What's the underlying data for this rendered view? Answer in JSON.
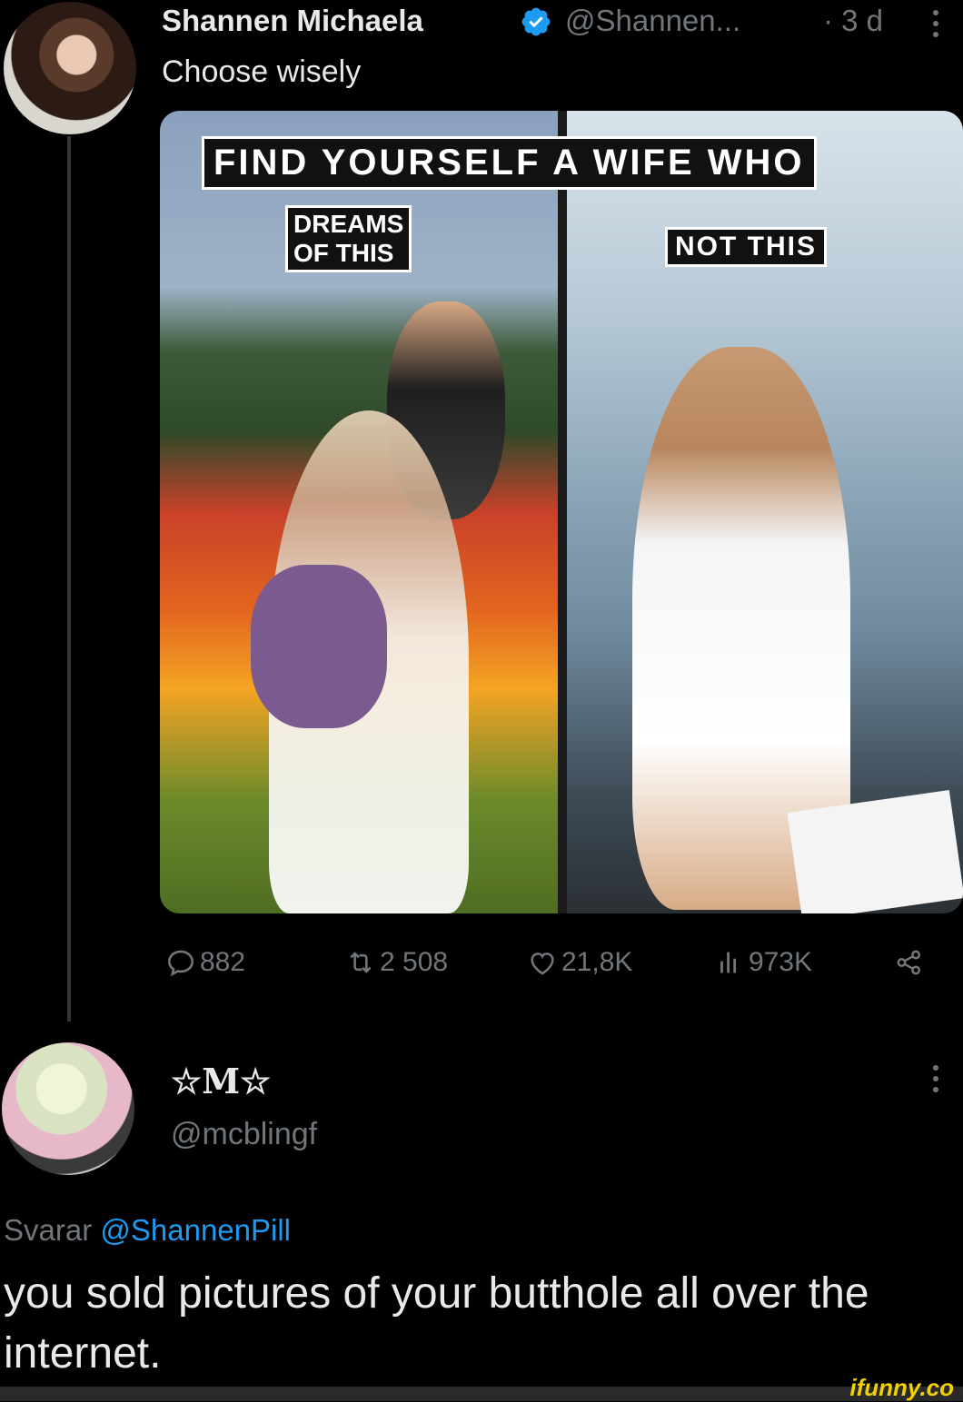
{
  "tweet": {
    "author_name": "Shannen Michaela",
    "handle": "@Shannen...",
    "time": "· 3 d",
    "text": "Choose wisely",
    "meme": {
      "top_label": "FIND YOURSELF A WIFE WHO",
      "left_label": "DREAMS\nOF THIS",
      "right_label": "NOT THIS"
    },
    "actions": {
      "replies": "882",
      "retweets": "2 508",
      "likes": "21,8K",
      "views": "973K"
    }
  },
  "reply": {
    "author_name": "☆M☆",
    "handle": "@mcblingf",
    "replying_prefix": "Svarar",
    "replying_to": "@ShannenPill",
    "text": "you sold pictures of your butthole all over the internet."
  },
  "watermark": "ifunny.co",
  "colors": {
    "background": "#000000",
    "text": "#e7e9ea",
    "secondary": "#71767b",
    "accent": "#1d9bf0",
    "watermark": "#f2d100"
  },
  "icons": [
    "verified-icon",
    "more-icon",
    "reply-icon",
    "retweet-icon",
    "like-icon",
    "views-icon",
    "share-icon"
  ]
}
